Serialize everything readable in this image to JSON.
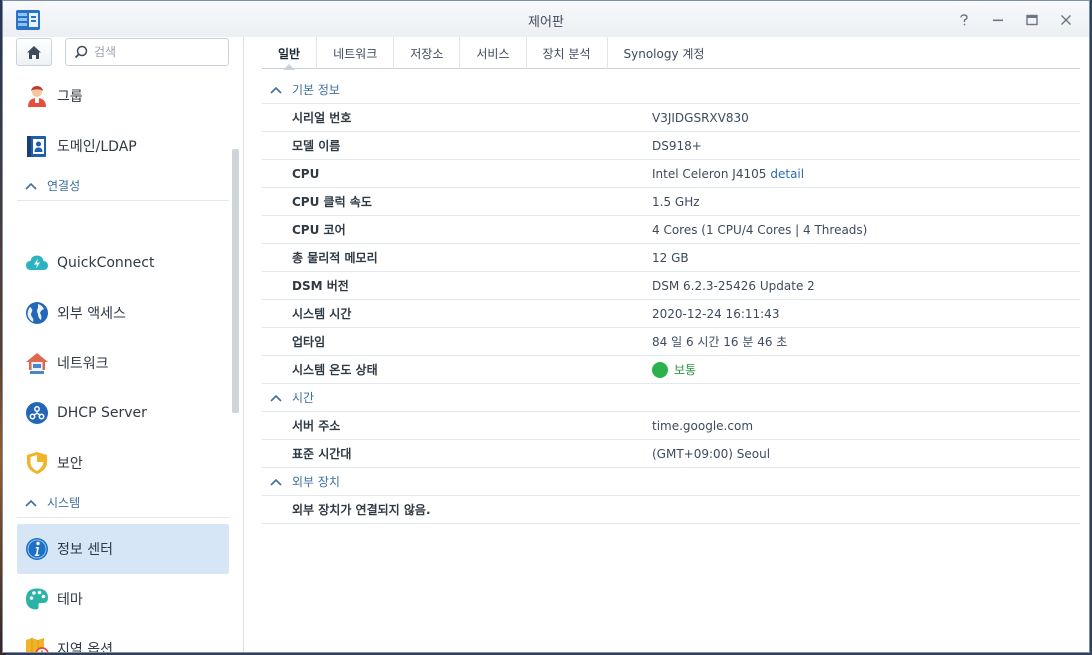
{
  "window": {
    "title": "제어판"
  },
  "search": {
    "placeholder": "검색"
  },
  "sidebar": {
    "items": [
      {
        "type": "item",
        "label": "그룹",
        "icon": "group-icon"
      },
      {
        "type": "item",
        "label": "도메인/LDAP",
        "icon": "domain-ldap-icon"
      },
      {
        "type": "section",
        "label": "연결성"
      },
      {
        "type": "item",
        "label": "QuickConnect",
        "icon": "quickconnect-icon"
      },
      {
        "type": "item",
        "label": "외부 액세스",
        "icon": "external-access-icon"
      },
      {
        "type": "item",
        "label": "네트워크",
        "icon": "network-icon"
      },
      {
        "type": "item",
        "label": "DHCP Server",
        "icon": "dhcp-server-icon"
      },
      {
        "type": "item",
        "label": "보안",
        "icon": "security-shield-icon"
      },
      {
        "type": "section",
        "label": "시스템"
      },
      {
        "type": "item",
        "label": "정보 센터",
        "icon": "info-center-icon",
        "active": true
      },
      {
        "type": "item",
        "label": "테마",
        "icon": "theme-palette-icon"
      },
      {
        "type": "item",
        "label": "지역 옵션",
        "icon": "regional-options-icon"
      }
    ]
  },
  "tabs": [
    {
      "label": "일반",
      "active": true
    },
    {
      "label": "네트워크"
    },
    {
      "label": "저장소"
    },
    {
      "label": "서비스"
    },
    {
      "label": "장치 분석"
    },
    {
      "label": "Synology 계정"
    }
  ],
  "general": {
    "basic_header": "기본 정보",
    "basic": [
      {
        "key": "시리얼 번호",
        "value": "V3JIDGSRXV830"
      },
      {
        "key": "모델 이름",
        "value": "DS918+"
      },
      {
        "key": "CPU",
        "value": "Intel Celeron J4105",
        "link": "detail"
      },
      {
        "key": "CPU 클럭 속도",
        "value": "1.5 GHz"
      },
      {
        "key": "CPU 코어",
        "value": "4 Cores (1 CPU/4 Cores | 4 Threads)"
      },
      {
        "key": "총 물리적 메모리",
        "value": "12 GB"
      },
      {
        "key": "DSM 버전",
        "value": "DSM 6.2.3-25426 Update 2"
      },
      {
        "key": "시스템 시간",
        "value": "2020-12-24 16:11:43"
      },
      {
        "key": "업타임",
        "value": "84 일 6 시간 16 분 46 초"
      },
      {
        "key": "시스템 온도 상태",
        "value": "보통",
        "status_color": "#2bb24c"
      }
    ],
    "time_header": "시간",
    "time": [
      {
        "key": "서버 주소",
        "value": "time.google.com"
      },
      {
        "key": "표준 시간대",
        "value": "(GMT+09:00) Seoul"
      }
    ],
    "external_header": "외부 장치",
    "external_message": "외부 장치가 연결되지 않음."
  },
  "colors": {
    "accent": "#3f6f9e",
    "active_bg": "#d6e6f6",
    "status_ok": "#2bb24c"
  }
}
